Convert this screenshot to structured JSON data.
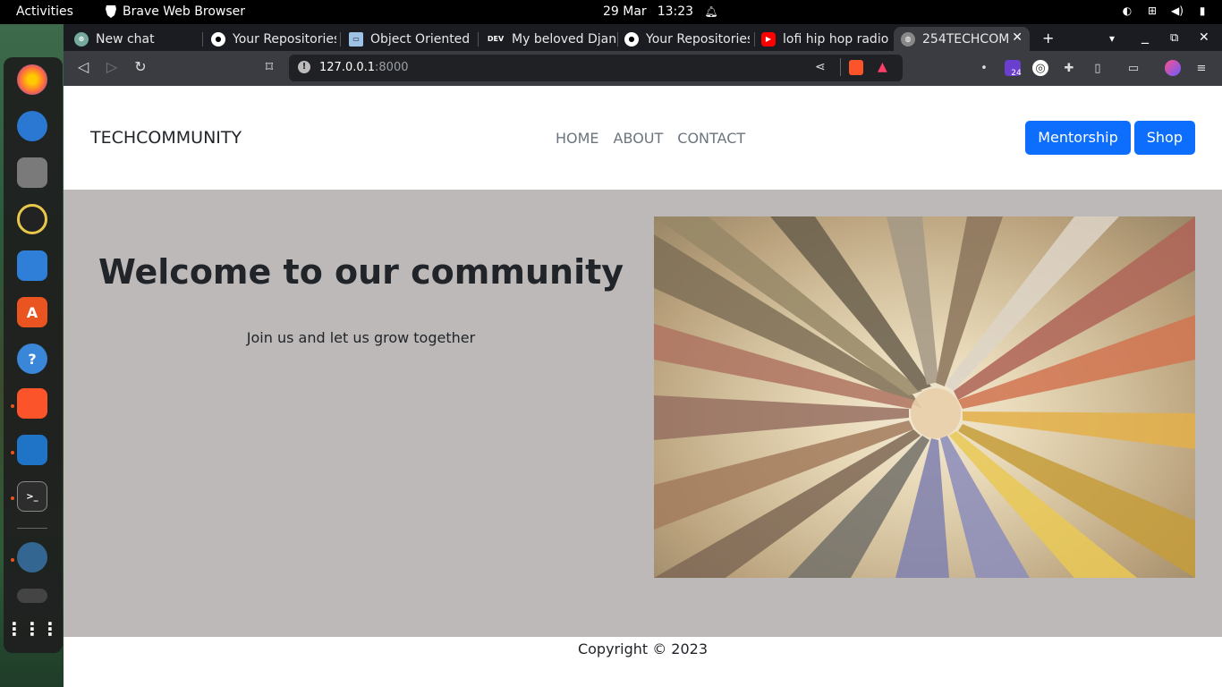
{
  "system": {
    "activities": "Activities",
    "app_name": "Brave Web Browser",
    "date": "29 Mar",
    "time": "13:23"
  },
  "browser": {
    "tabs": [
      {
        "title": "New chat",
        "icon": "chatgpt-icon"
      },
      {
        "title": "Your Repositories",
        "icon": "github-icon"
      },
      {
        "title": "Object Oriented",
        "icon": "book-icon"
      },
      {
        "title": "My beloved Djang",
        "icon": "dev-icon"
      },
      {
        "title": "Your Repositories",
        "icon": "github-icon"
      },
      {
        "title": "lofi hip hop radio",
        "icon": "youtube-icon"
      },
      {
        "title": "254TECHCOM",
        "icon": "globe-icon",
        "active": true
      }
    ],
    "url_host": "127.0.0.1",
    "url_port": ":8000",
    "rewards_badge": "24"
  },
  "site": {
    "brand": "TECHCOMMUNITY",
    "nav": [
      "HOME",
      "ABOUT",
      "CONTACT"
    ],
    "buttons": [
      "Mentorship",
      "Shop"
    ],
    "hero_title": "Welcome to our community",
    "hero_subtitle": "Join us and let us grow together",
    "footer": "Copyright © 2023"
  },
  "colors": {
    "primary": "#0d6efd",
    "hero_bg": "#bdb9b9",
    "nav_link": "#6c757d"
  }
}
